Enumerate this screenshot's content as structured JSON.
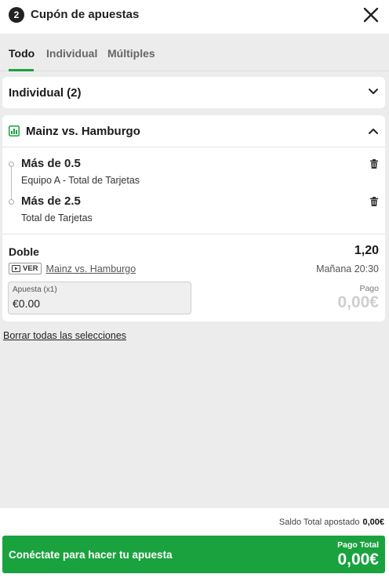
{
  "header": {
    "count": "2",
    "title": "Cupón de apuestas",
    "close_icon": "close-icon"
  },
  "tabs": [
    {
      "label": "Todo",
      "active": true
    },
    {
      "label": "Individual",
      "active": false
    },
    {
      "label": "Múltiples",
      "active": false
    }
  ],
  "single_section": {
    "label": "Individual (2)",
    "expanded": false
  },
  "event": {
    "name": "Mainz vs. Hamburgo",
    "icon": "stats-icon",
    "expanded": true,
    "selections": [
      {
        "title": "Más de 0.5",
        "market": "Equipo A - Total de Tarjetas"
      },
      {
        "title": "Más de 2.5",
        "market": "Total de Tarjetas"
      }
    ],
    "bet_type": "Doble",
    "odds": "1,20",
    "watch_label": "VER",
    "match_link": "Mainz vs. Hamburgo",
    "kickoff": "Mañana 20:30",
    "stake": {
      "label": "Apuesta (x1)",
      "value": "€0.00"
    },
    "payout": {
      "label": "Pago",
      "value": "0,00€"
    }
  },
  "clear_all": "Borrar todas las selecciones",
  "footer": {
    "saldo_label": "Saldo Total apostado",
    "saldo_value": "0,00€",
    "cta_label": "Conéctate para hacer tu apuesta",
    "total_label": "Pago Total",
    "total_value": "0,00€"
  },
  "colors": {
    "accent": "#1aa23f",
    "background": "#ececec",
    "card": "#ffffff"
  }
}
